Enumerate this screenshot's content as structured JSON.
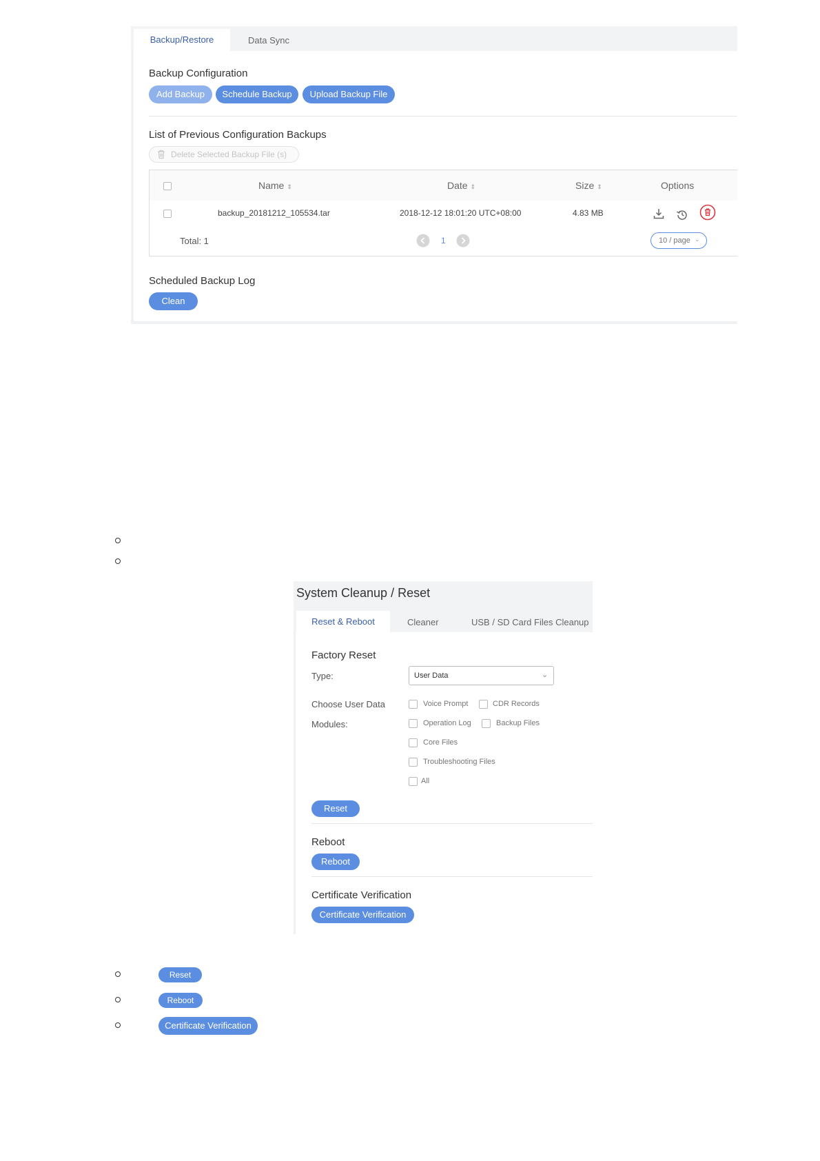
{
  "backup_panel": {
    "tabs": [
      {
        "label": "Backup/Restore"
      },
      {
        "label": "Data Sync"
      }
    ],
    "backup_configuration": {
      "title": "Backup Configuration",
      "buttons": {
        "add": "Add Backup",
        "schedule": "Schedule Backup",
        "upload": "Upload Backup File"
      }
    },
    "previous_backups": {
      "title": "List of Previous Configuration Backups",
      "delete_selected": "Delete Selected Backup File (s)",
      "columns": {
        "name": "Name",
        "date": "Date",
        "size": "Size",
        "options": "Options"
      },
      "rows": [
        {
          "name": "backup_20181212_105534.tar",
          "date": "2018-12-12 18:01:20 UTC+08:00",
          "size": "4.83 MB"
        }
      ],
      "total": "Total: 1",
      "page_number": "1",
      "page_size": "10 / page"
    },
    "scheduled_log": {
      "title": "Scheduled Backup Log",
      "clean_button": "Clean"
    }
  },
  "system_cleanup": {
    "title": "System Cleanup / Reset",
    "tabs": [
      {
        "label": "Reset & Reboot"
      },
      {
        "label": "Cleaner"
      },
      {
        "label": "USB / SD Card Files Cleanup"
      }
    ],
    "factory_reset": {
      "title": "Factory Reset",
      "type_label": "Type:",
      "type_value": "User Data",
      "modules_label_line1": "Choose User Data",
      "modules_label_line2": "Modules:",
      "modules": {
        "voice_prompt": "Voice Prompt",
        "cdr_records": "CDR Records",
        "operation_log": "Operation Log",
        "backup_files": "Backup Files",
        "core_files": "Core Files",
        "troubleshooting_files": "Troubleshooting Files",
        "all": "All"
      },
      "reset_button": "Reset"
    },
    "reboot": {
      "title": "Reboot",
      "button": "Reboot"
    },
    "certificate": {
      "title": "Certificate Verification",
      "button": "Certificate Verification"
    }
  },
  "bottom_list": {
    "reset_button": "Reset",
    "reboot_button": "Reboot",
    "certificate_button": "Certificate Verification"
  },
  "colors": {
    "primary": "#5b8de0",
    "tab_active_text": "#3b5fa8",
    "delete_red": "#d9363e"
  }
}
